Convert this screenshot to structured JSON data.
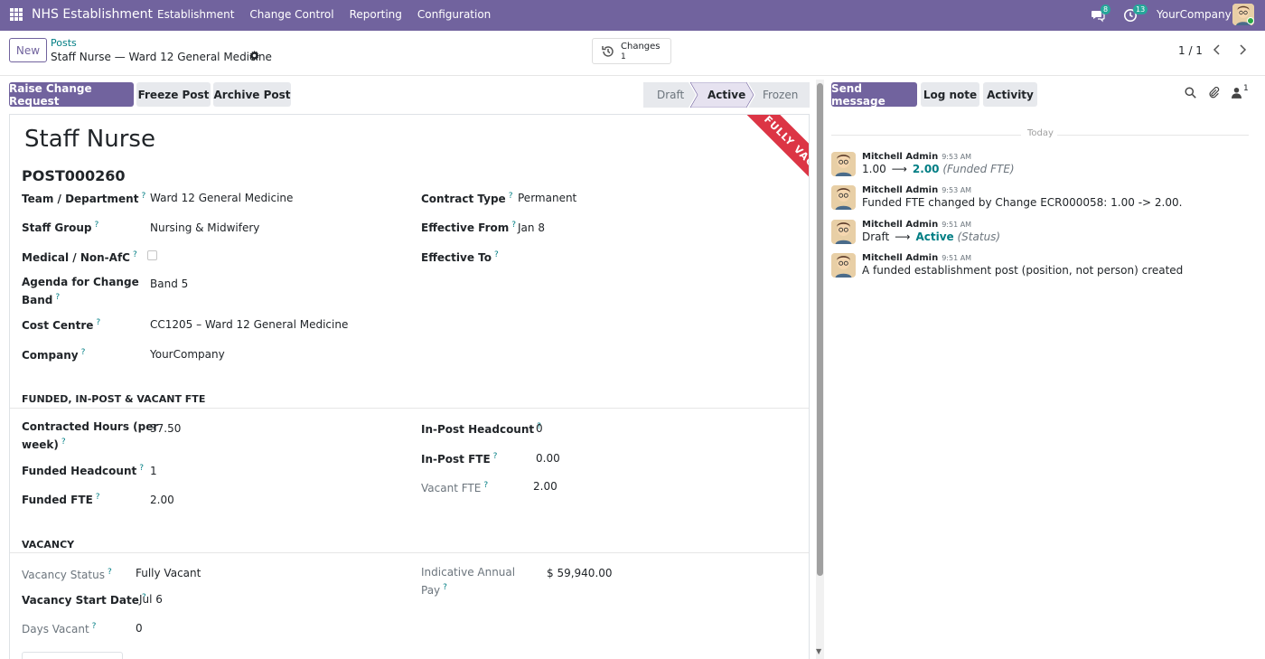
{
  "navbar": {
    "brand": "NHS Establishment",
    "menu": [
      "Establishment",
      "Change Control",
      "Reporting",
      "Configuration"
    ],
    "messages_count": "8",
    "activities_count": "13",
    "company": "YourCompany"
  },
  "control_panel": {
    "new_label": "New",
    "breadcrumb": "Posts",
    "record_title": "Staff Nurse — Ward 12 General Medicine",
    "changes_label": "Changes",
    "changes_count": "1",
    "pager": "1 / 1"
  },
  "actions": {
    "raise_change": "Raise Change Request",
    "freeze": "Freeze Post",
    "archive": "Archive Post"
  },
  "statusbar": {
    "stages": [
      "Draft",
      "Active",
      "Frozen"
    ],
    "current": "Active"
  },
  "form": {
    "ribbon": "FULLY VACANT",
    "title": "Staff Nurse",
    "reference": "POST000260",
    "left": [
      {
        "label": "Team / Department",
        "value": "Ward 12 General Medicine"
      },
      {
        "label": "Staff Group",
        "value": "Nursing & Midwifery"
      },
      {
        "label": "Medical / Non-AfC",
        "value": ""
      },
      {
        "label": "Agenda for Change",
        "label2": "Band",
        "value": "Band 5"
      },
      {
        "label": "Cost Centre",
        "value": "CC1205 – Ward 12 General Medicine"
      },
      {
        "label": "Company",
        "value": "YourCompany"
      }
    ],
    "right": [
      {
        "label": "Contract Type",
        "value": "Permanent"
      },
      {
        "label": "Effective From",
        "value": "Jan 8"
      },
      {
        "label": "Effective To",
        "value": ""
      }
    ],
    "fte_section": "FUNDED, IN-POST & VACANT FTE",
    "fte_left": [
      {
        "label": "Contracted Hours (per",
        "label2": "week)",
        "value": "37.50"
      },
      {
        "label": "Funded Headcount",
        "value": "1"
      },
      {
        "label": "Funded FTE",
        "value": "2.00"
      }
    ],
    "fte_right": [
      {
        "label": "In-Post Headcount",
        "value": "0"
      },
      {
        "label": "In-Post FTE",
        "value": "0.00"
      },
      {
        "label": "Vacant FTE",
        "value": "2.00"
      }
    ],
    "vacancy_section": "VACANCY",
    "vacancy_left": [
      {
        "label": "Vacancy Status",
        "value": "Fully Vacant"
      },
      {
        "label": "Vacancy Start Date",
        "value": "Jul 6"
      },
      {
        "label": "Days Vacant",
        "value": "0"
      }
    ],
    "vacancy_right": [
      {
        "label": "Indicative Annual",
        "label2": "Pay",
        "value": "$ 59,940.00"
      }
    ],
    "help_mark": "?"
  },
  "chatter": {
    "send_message": "Send message",
    "log_note": "Log note",
    "activity": "Activity",
    "followers_count": "1",
    "today": "Today",
    "messages": [
      {
        "author": "Mitchell Admin",
        "time": "9:53 AM",
        "old": "1.00",
        "new": "2.00",
        "field": "(Funded FTE)"
      },
      {
        "author": "Mitchell Admin",
        "time": "9:53 AM",
        "text": "Funded FTE changed by Change ECR000058: 1.00 -> 2.00."
      },
      {
        "author": "Mitchell Admin",
        "time": "9:51 AM",
        "old": "Draft",
        "new": "Active",
        "field": "(Status)"
      },
      {
        "author": "Mitchell Admin",
        "time": "9:51 AM",
        "text": "A funded establishment post (position, not person) created"
      }
    ]
  },
  "colors": {
    "brand": "#71639e",
    "link": "#017e84",
    "ribbon": "#dc3545"
  }
}
